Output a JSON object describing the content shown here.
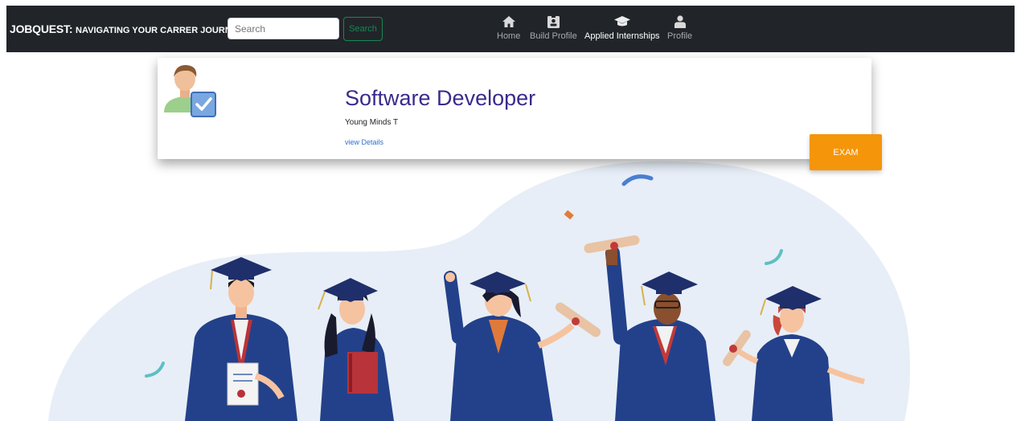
{
  "navbar": {
    "brand_main": "JOBQUEST:",
    "brand_sub": "NAVIGATING YOUR CARRER JOURNEY",
    "search_placeholder": "Search",
    "search_button": "Search",
    "items": [
      {
        "label": "Home",
        "icon": "home-icon"
      },
      {
        "label": "Build Profile",
        "icon": "id-badge-icon"
      },
      {
        "label": "Applied Internships",
        "icon": "graduation-cap-icon"
      },
      {
        "label": "Profile",
        "icon": "user-icon"
      }
    ]
  },
  "card": {
    "title": "Software Developer",
    "company": "Young Minds T",
    "link": "view Details",
    "avatar_icon": "verified-user-icon"
  },
  "exam_button": "EXAM",
  "hero": {
    "icon": "graduates-illustration"
  },
  "colors": {
    "navbar": "#212529",
    "title": "#3b2a8c",
    "link": "#2f6fd0",
    "exam": "#f5950a",
    "gown": "#23418a",
    "blob": "#e7eef7",
    "search_green": "#198754"
  }
}
